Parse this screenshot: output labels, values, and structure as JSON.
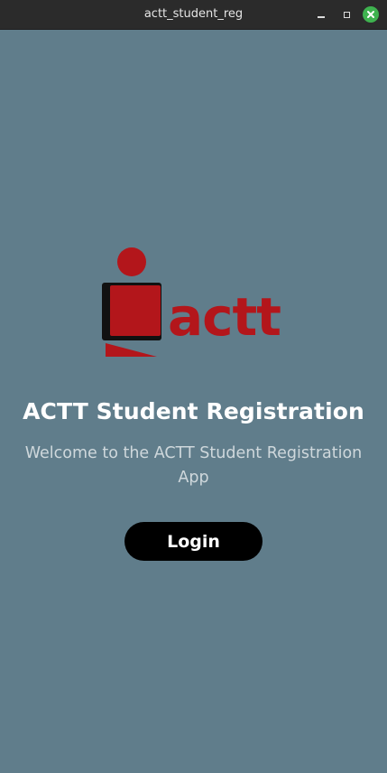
{
  "window": {
    "title": "actt_student_reg",
    "controls": {
      "minimize": "minimize",
      "maximize": "maximize",
      "close": "close"
    }
  },
  "logo": {
    "text": "actt",
    "colors": {
      "primary": "#b3161b",
      "dark": "#111111"
    }
  },
  "main": {
    "heading": "ACTT Student Registration",
    "subtitle": "Welcome to the ACTT Student Registration App",
    "login_label": "Login"
  },
  "colors": {
    "background": "#607d8b",
    "titlebar": "#2b2b2b",
    "close_button": "#3eb34f",
    "button": "#000000",
    "button_text": "#ffffff"
  }
}
